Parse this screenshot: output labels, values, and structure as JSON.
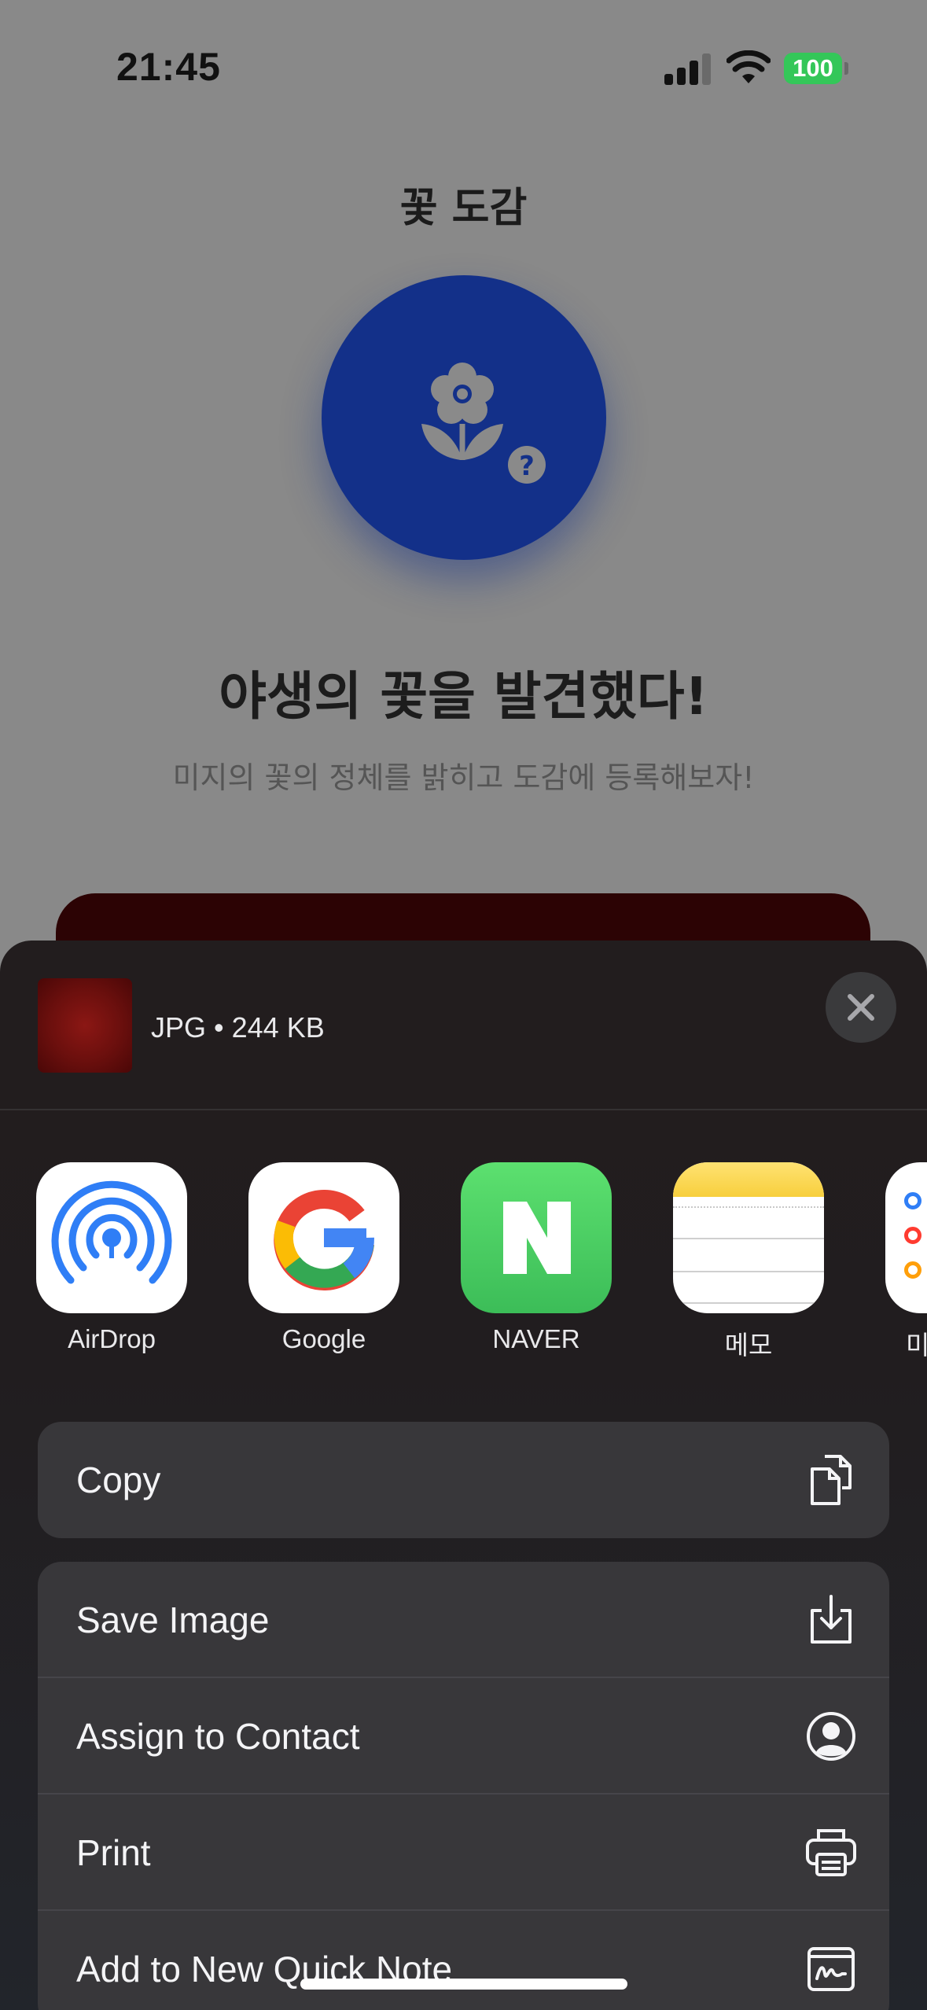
{
  "status_bar": {
    "time": "21:45",
    "battery": "100"
  },
  "app": {
    "title": "꽃 도감",
    "headline": "야생의 꽃을 발견했다!",
    "subline": "미지의 꽃의 정체를 밝히고 도감에 등록해보자!",
    "hero_icon": "flower-question-icon",
    "hero_color": "#133089"
  },
  "share_sheet": {
    "file_info": "JPG • 244 KB",
    "apps": [
      {
        "label": "AirDrop",
        "icon": "airdrop-icon"
      },
      {
        "label": "Google",
        "icon": "google-icon"
      },
      {
        "label": "NAVER",
        "icon": "naver-icon"
      },
      {
        "label": "메모",
        "icon": "notes-icon"
      },
      {
        "label": "미",
        "icon": "reminders-icon"
      }
    ],
    "copy_group": [
      {
        "label": "Copy",
        "icon": "copy-icon"
      }
    ],
    "actions": [
      {
        "label": "Save Image",
        "icon": "save-image-icon"
      },
      {
        "label": "Assign to Contact",
        "icon": "contact-icon"
      },
      {
        "label": "Print",
        "icon": "printer-icon"
      },
      {
        "label": "Add to New Quick Note",
        "icon": "quick-note-icon"
      }
    ]
  }
}
